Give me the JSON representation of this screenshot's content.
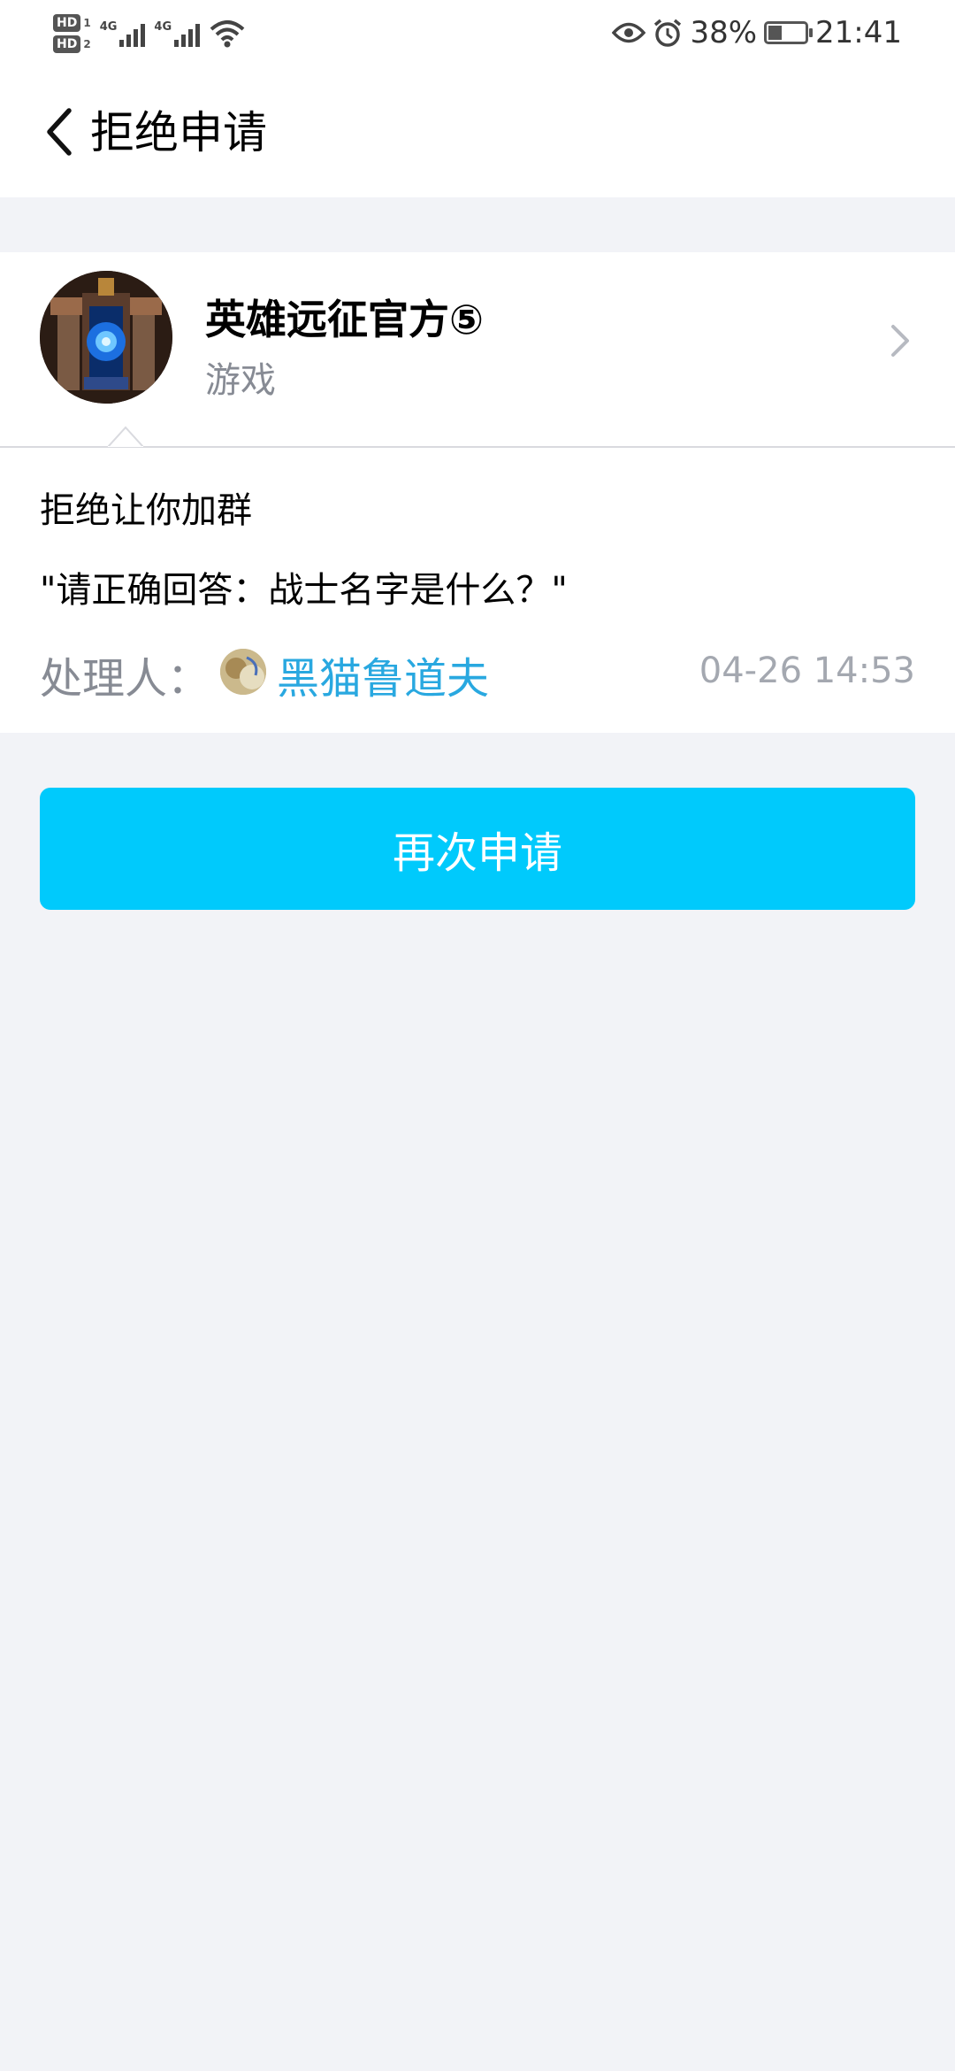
{
  "status_bar": {
    "net1": "4G",
    "net2": "4G",
    "battery_percent": "38%",
    "battery_level": 0.38,
    "time": "21:41",
    "icons": [
      "hd-icon",
      "signal-icon",
      "wifi-icon",
      "eye-icon",
      "alarm-icon",
      "battery-icon"
    ]
  },
  "nav": {
    "title": "拒绝申请",
    "back_icon": "chevron-left-icon"
  },
  "group": {
    "name": "英雄远征官方⑤",
    "category": "游戏",
    "chevron_icon": "chevron-right-icon"
  },
  "message": {
    "line1": "拒绝让你加群",
    "line2": "\"请正确回答：战士名字是什么？\"",
    "handler_label": "处理人：",
    "handler_name": "黑猫鲁道夫",
    "time": "04-26 14:53"
  },
  "actions": {
    "reapply_label": "再次申请"
  },
  "colors": {
    "accent_button": "#00cafc",
    "link": "#29a8e0",
    "background": "#f2f3f7"
  }
}
